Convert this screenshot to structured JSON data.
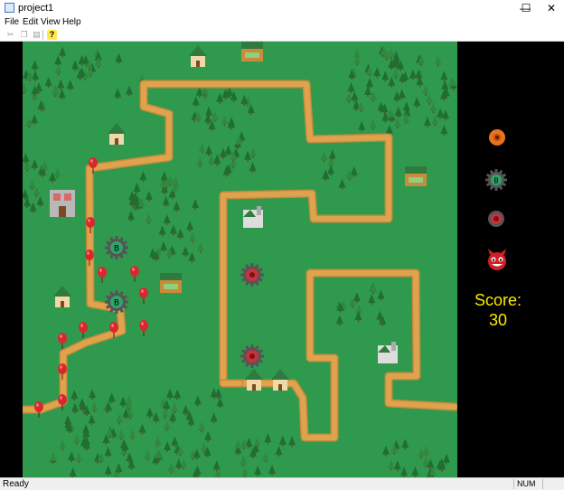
{
  "window": {
    "title": "project1",
    "minimize_glyph": "—",
    "maximize_glyph": "☐",
    "close_glyph": "✕"
  },
  "menu": {
    "items": [
      "File",
      "Edit",
      "View",
      "Help"
    ]
  },
  "toolbar": {
    "buttons": [
      {
        "icon": "cut-icon",
        "glyph": "✂"
      },
      {
        "icon": "copy-icon",
        "glyph": "❐"
      },
      {
        "icon": "paste-icon",
        "glyph": "▤"
      },
      {
        "icon": "help-icon",
        "glyph": "?"
      }
    ]
  },
  "sidebar": {
    "tower_icons": [
      {
        "name": "fire-tower-icon",
        "color": "#e8731a"
      },
      {
        "name": "bomb-tower-icon",
        "color": "#2fa56a"
      },
      {
        "name": "saw-tower-icon",
        "color": "#c8323c"
      },
      {
        "name": "devil-enemy-icon",
        "color": "#d41f26"
      }
    ],
    "score_label": "Score:",
    "score_value": "30"
  },
  "colors": {
    "grass": "#2f9a4e",
    "path": "#dfa24e",
    "path_edge": "#c98b3a",
    "tree": "#1f6e32",
    "tree_light": "#2f8a40",
    "house_roof": "#2f7a3e",
    "balloon": "#d8282e",
    "bomb_tower": "#2fa56a",
    "saw_tower": "#c8323c",
    "score": "#ffeb00"
  },
  "status": {
    "text": "Ready",
    "num_indicator": "NUM"
  }
}
